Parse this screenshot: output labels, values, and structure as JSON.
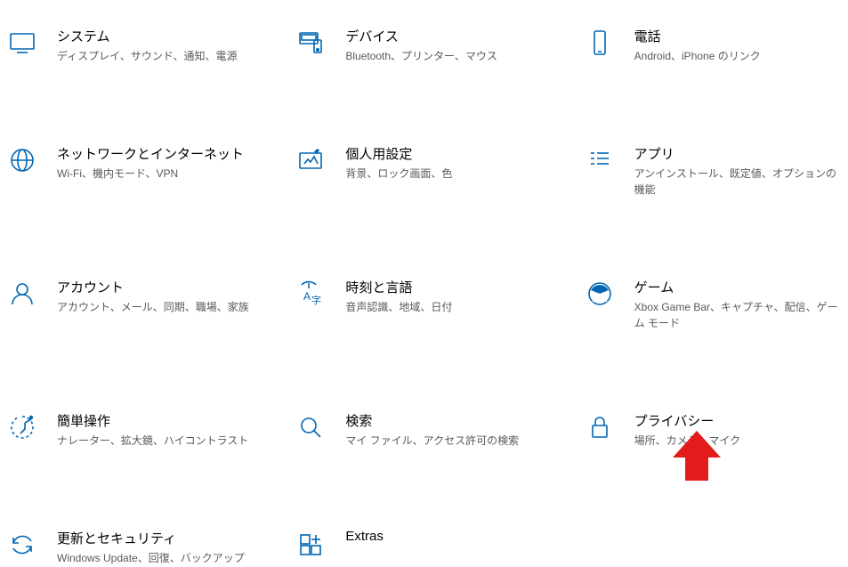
{
  "accent": "#0066b4",
  "items": [
    {
      "id": "system",
      "title": "システム",
      "desc": "ディスプレイ、サウンド、通知、電源"
    },
    {
      "id": "devices",
      "title": "デバイス",
      "desc": "Bluetooth、プリンター、マウス"
    },
    {
      "id": "phone",
      "title": "電話",
      "desc": "Android、iPhone のリンク"
    },
    {
      "id": "network",
      "title": "ネットワークとインターネット",
      "desc": "Wi-Fi、機内モード、VPN"
    },
    {
      "id": "personal",
      "title": "個人用設定",
      "desc": "背景、ロック画面、色"
    },
    {
      "id": "apps",
      "title": "アプリ",
      "desc": "アンインストール、既定値、オプションの機能"
    },
    {
      "id": "accounts",
      "title": "アカウント",
      "desc": "アカウント、メール、同期、職場、家族"
    },
    {
      "id": "time",
      "title": "時刻と言語",
      "desc": "音声認識、地域、日付"
    },
    {
      "id": "gaming",
      "title": "ゲーム",
      "desc": "Xbox Game Bar、キャプチャ、配信、ゲーム モード"
    },
    {
      "id": "ease",
      "title": "簡単操作",
      "desc": "ナレーター、拡大鏡、ハイコントラスト"
    },
    {
      "id": "search",
      "title": "検索",
      "desc": "マイ ファイル、アクセス許可の検索"
    },
    {
      "id": "privacy",
      "title": "プライバシー",
      "desc": "場所、カメラ、マイク"
    },
    {
      "id": "update",
      "title": "更新とセキュリティ",
      "desc": "Windows Update、回復、バックアップ"
    },
    {
      "id": "extras",
      "title": "Extras",
      "desc": ""
    }
  ],
  "annotation_arrow": {
    "target": "privacy",
    "color": "#e21b1b"
  }
}
